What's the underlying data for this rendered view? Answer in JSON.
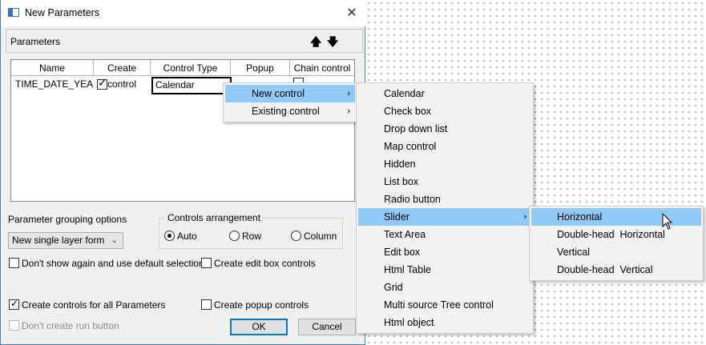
{
  "window": {
    "title": "New Parameters",
    "close_glyph": "✕"
  },
  "group_bar": {
    "label": "Parameters",
    "up_glyph": "🡅",
    "down_glyph": "🡇"
  },
  "table": {
    "columns": [
      "Name",
      "Create control",
      "Control Type",
      "Popup",
      "Chain control"
    ],
    "rows": [
      {
        "name": "TIME_DATE_YEAR",
        "create_control": true,
        "control_type": "Calendar",
        "chain_control": false
      }
    ]
  },
  "grouping": {
    "label": "Parameter grouping options",
    "selected": "New single layer form"
  },
  "arrangement": {
    "label": "Controls arrangement",
    "options": [
      "Auto",
      "Row",
      "Column"
    ],
    "selected": "Auto"
  },
  "checkboxes": {
    "dont_show": {
      "label": "Don't show again and use default selection",
      "checked": false
    },
    "edit_box": {
      "label": "Create edit box controls",
      "checked": false
    },
    "all_params": {
      "label": "Create controls for all Parameters",
      "checked": true
    },
    "popup": {
      "label": "Create popup controls",
      "checked": false
    },
    "no_run": {
      "label": "Don't create run button",
      "checked": false,
      "disabled": true
    }
  },
  "buttons": {
    "ok": "OK",
    "cancel": "Cancel"
  },
  "context_menu": {
    "items": [
      {
        "label": "New control",
        "highlighted": true
      },
      {
        "label": "Existing control",
        "highlighted": false
      }
    ],
    "submenu_glyph": "›"
  },
  "new_control_menu": {
    "items": [
      "Calendar",
      "Check box",
      "Drop down list",
      "Map control",
      "Hidden",
      "List box",
      "Radio button",
      "Slider",
      "Text Area",
      "Edit box",
      "Html Table",
      "Grid",
      "Multi source Tree control",
      "Html object"
    ],
    "highlighted": "Slider"
  },
  "slider_menu": {
    "items": [
      "Horizontal",
      "Double-head  Horizontal",
      "Vertical",
      "Double-head  Vertical"
    ],
    "highlighted": "Horizontal"
  },
  "colors": {
    "highlight": "#91c9f7",
    "accent": "#0078d7",
    "title_border": "#4a7fc8"
  },
  "icons": {
    "app": "window-icon",
    "cursor": "mouse-pointer-icon"
  }
}
